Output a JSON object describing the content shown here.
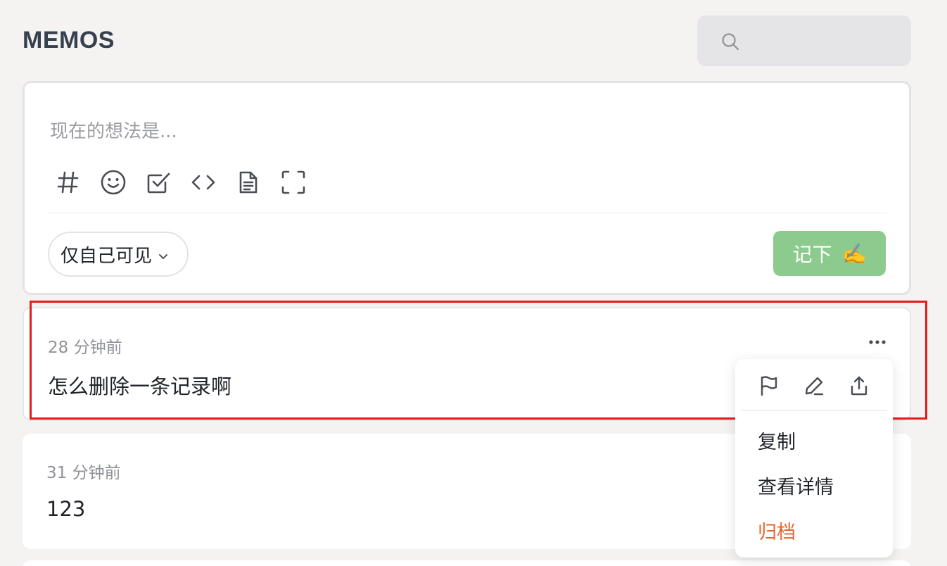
{
  "header": {
    "title": "MEMOS",
    "search_placeholder": ""
  },
  "editor": {
    "placeholder": "现在的想法是...",
    "tools": [
      "hash-icon",
      "emoji-icon",
      "checkbox-icon",
      "code-icon",
      "file-icon",
      "fullscreen-icon"
    ],
    "visibility": "仅自己可见",
    "submit_label": "记下",
    "submit_emoji": "✍️"
  },
  "memos": [
    {
      "time": "28 分钟前",
      "content": "怎么删除一条记录啊"
    },
    {
      "time": "31 分钟前",
      "content": "123"
    }
  ],
  "menu": {
    "icons": [
      "flag-icon",
      "edit-icon",
      "share-icon"
    ],
    "items": {
      "copy": "复制",
      "view_detail": "查看详情",
      "archive": "归档"
    }
  },
  "colors": {
    "accent_green": "#8ccb8d",
    "archive_orange": "#e6652d",
    "highlight_red": "#e31b1b"
  }
}
